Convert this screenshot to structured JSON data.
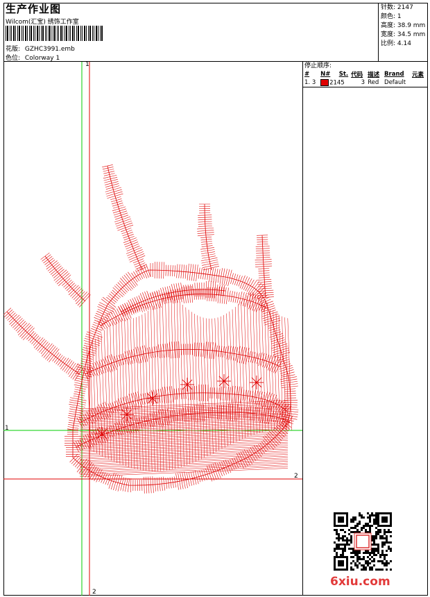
{
  "header": {
    "title": "生产作业图",
    "subtitle": "Wilcom(汇宝) 绣饰工作室",
    "design_label": "花版:",
    "design_value": "GZHC3991.emb",
    "colorway_label": "色位:",
    "colorway_value": "Colorway 1"
  },
  "stats": {
    "stitches": "针数: 2147",
    "colors": "颜色: 1",
    "height": "高度: 38.9 mm",
    "width": "宽度: 34.5 mm",
    "scale": "比例: 4.14"
  },
  "stop_sequence": {
    "title": "停止顺序:",
    "columns": [
      "#",
      "N#",
      "St.",
      "代码",
      "描述",
      "Brand",
      "元素"
    ],
    "rows": [
      {
        "num": "1.",
        "needle": "3",
        "stitches": "2145",
        "code": "3",
        "description": "Red",
        "brand": "Default",
        "elements": ""
      }
    ]
  },
  "axes": {
    "label_1_left": "1",
    "label_1_top": "1",
    "label_2_right": "2",
    "label_2_bottom": "2"
  },
  "colors": {
    "thread": "#e00000",
    "green_axis": "#00cc00",
    "red_axis": "#e00000"
  },
  "watermark": "6xiu.com"
}
